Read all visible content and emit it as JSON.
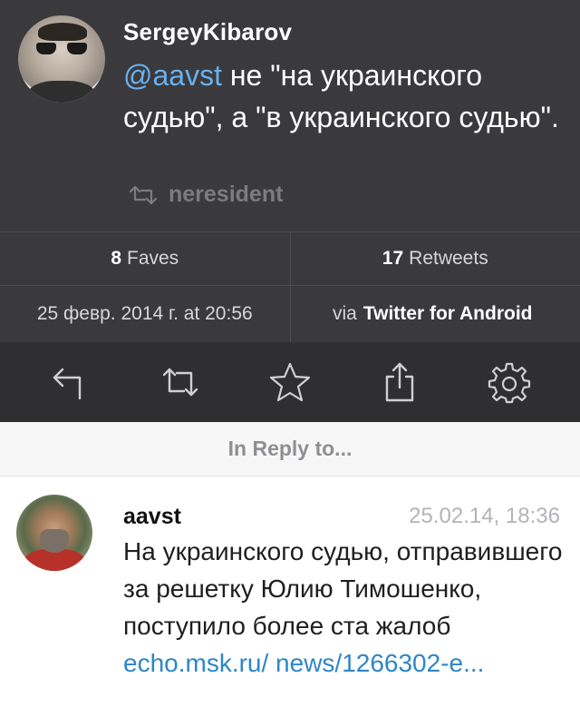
{
  "tweet": {
    "username": "SergeyKibarov",
    "mention": "@aavst",
    "text": " не \"на украинского судью\", а \"в украинского судью\".",
    "retweeted_by": "neresident",
    "faves_count": "8",
    "faves_label": "Faves",
    "retweets_count": "17",
    "retweets_label": "Retweets",
    "date": "25 февр. 2014 г. at 20:56",
    "via_prefix": "via",
    "via_app": "Twitter for Android"
  },
  "toolbar": {
    "icons": [
      "reply-icon",
      "retweet-icon",
      "star-icon",
      "share-icon",
      "gear-icon"
    ]
  },
  "reply_header": "In Reply to...",
  "reply": {
    "username": "aavst",
    "timestamp": "25.02.14, 18:36",
    "text": "На украинского судью, отправившего за решетку Юлию Тимошенко, поступило более ста жалоб ",
    "link": "echo.msk.ru/ news/1266302-e..."
  },
  "colors": {
    "dark_bg": "#3a3a3d",
    "toolbar_bg": "#2f2f31",
    "mention": "#6ab0ef",
    "link": "#2f86c6"
  }
}
